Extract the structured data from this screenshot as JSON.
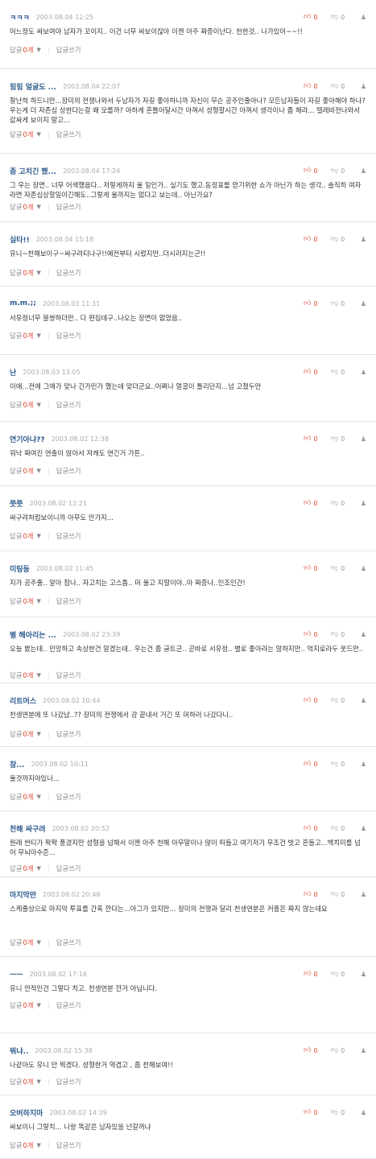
{
  "labels": {
    "reply": "답글",
    "write_reply": "답글쓰기",
    "like_icon": "thumbs-up-icon",
    "dislike_icon": "thumbs-down-icon",
    "more_icon": "person-icon"
  },
  "colors": {
    "accent": "#e0462f",
    "author": "#2e5a8c",
    "date": "#aaaaaa",
    "divider": "#e4e4e4"
  },
  "comments": [
    {
      "author": "ㅋㅋㅋ",
      "date": "2003.08.04 12:25",
      "likes": "0",
      "dislikes": "0",
      "reply_count": "0개",
      "text": "어느정도 싸보여야 남자가 꼬이지.. 이건 너무 싸보이잖아 이젠 아주 짜증이난다. 천한것.. 나가있어~~!!"
    },
    {
      "author": "힘힘 얼굴도 ...",
      "date": "2003.08.04 22:07",
      "likes": "0",
      "dislikes": "0",
      "reply_count": "0개",
      "text": "잘난척 하드니만...장미의 전쟁나와서 두남자가 자길 좋아하니까 자신이 무슨 공주인줄아나? 모든남자들이 자길 좋아해야 하나? 우는게 더 자존심 상한다는걸 왜 모를까? 아하게 혼틀어달시간 아껴서 성형할시간 아껴서 생각이나 좀 해라... 텔레비전나와서 값싸게 보이지 말고..."
    },
    {
      "author": "좀 고치긴 했...",
      "date": "2003.08.04 17:24",
      "likes": "0",
      "dislikes": "0",
      "reply_count": "0개",
      "text": "그 우는 장면.. 너무 어색했음다.. 저렇게까지 울 일인가.. 싶기도 했고.동정표를 얻기위한 쇼가 아닌가 하는 생각.. 솔직히 여자라면 자존심상할일이긴해도..그렇게 울까지는 없다고 보는데.. 아닌가요?"
    },
    {
      "author": "실타!!",
      "date": "2003.08.04 15:18",
      "likes": "0",
      "dislikes": "0",
      "reply_count": "0개",
      "text": "유니~천해보이구~싸구려티나구!!예전부터 시렀지만..더시러지는군!!"
    },
    {
      "author": "m.m.;;",
      "date": "2003.08.03 11:31",
      "likes": "0",
      "dislikes": "0",
      "reply_count": "0개",
      "text": "서유정너무 불쌍하더만.. 다 편집데구..나오는 장면이 없었음.."
    },
    {
      "author": "난",
      "date": "2003.08.03 13:05",
      "likes": "0",
      "dislikes": "0",
      "reply_count": "0개",
      "text": "이애...전에 그애가 맞나 긴가민가 했는데 맞더군요..어쩌나 얼굴이 틀리던지...넘 고쳤두만"
    },
    {
      "author": "연기아냐??",
      "date": "2003.08.02 12:38",
      "likes": "0",
      "dislikes": "0",
      "reply_count": "0개",
      "text": "워낙 짜여진 연출이 많아서 저캐도 연긴거 가튼.."
    },
    {
      "author": "쯧쯧",
      "date": "2003.08.02 12:21",
      "likes": "0",
      "dislikes": "0",
      "reply_count": "0개",
      "text": "싸구려처럼보이니까 아무도 안가지..."
    },
    {
      "author": "미팅등",
      "date": "2003.08.02 11:45",
      "likes": "0",
      "dislikes": "0",
      "reply_count": "0개",
      "text": "지가 공주줄.. 알아 참나.. 자고치는 고스톱.. 머 울고 지랄이야..아 짜증나..인조인간!"
    },
    {
      "author": "별 헤아리는 ...",
      "date": "2003.08.02 23:39",
      "likes": "0",
      "dislikes": "0",
      "reply_count": "0개",
      "text": "오늘 봤는데.. 민망하고 속상한건 알겠는데.. 우는건 좀 글트군.. 곧바로 서유정.. 별로 좋아라는 않하지만.. 억지로라두 웃드만.."
    },
    {
      "author": "리트머스",
      "date": "2003.08.02 10:44",
      "likes": "0",
      "dislikes": "0",
      "reply_count": "0개",
      "text": "천생연분에 또 나갔냠..?? 장미의 전쟁에서 걍 끝내서 거긴 또 머하러 나갔다니.."
    },
    {
      "author": "참...",
      "date": "2003.08.02 10:11",
      "likes": "0",
      "dislikes": "0",
      "reply_count": "0개",
      "text": "울것까지야있나..."
    },
    {
      "author": "천해 싸구려",
      "date": "2003.08.02 20:52",
      "likes": "0",
      "dislikes": "0",
      "reply_count": "0개",
      "text": "원래 싼티가 팍팍 풍겼지만 성형을 넘해서 이젠 아주 천해 아무말이나 많이 떠들고 여기저기 무조건 벗고 흔들고...백치미를 넘어 무뇌아수준..."
    },
    {
      "author": "마지막만",
      "date": "2003.08.02 20:48",
      "likes": "0",
      "dislikes": "0",
      "reply_count": "0개",
      "text": "스케줄상으로 마지막 투표를 간혹 깐다는...아그가 있지만... 장미의 전쟁과 달리 천생연분은 커플은 짜지 않는데요"
    },
    {
      "author": "ㅡㅡ",
      "date": "2003.08.02 17:16",
      "likes": "0",
      "dislikes": "0",
      "reply_count": "0개",
      "text": "유니 안적인건 그렇다 치고. 천생연분 깐거 아닙니다."
    },
    {
      "author": "뭐냐..",
      "date": "2003.08.02 15:38",
      "likes": "0",
      "dislikes": "0",
      "reply_count": "0개",
      "text": "나같아도 유니 안 찍겠다. 성형한거 역겹고 , 좀 천해보여!!"
    },
    {
      "author": "오버하지마",
      "date": "2003.08.02 14:39",
      "likes": "0",
      "dislikes": "0",
      "reply_count": "0개",
      "text": "싸보이니 그렇치... 니랑 똑같은 남자있을 넌갈꺼냐"
    }
  ]
}
